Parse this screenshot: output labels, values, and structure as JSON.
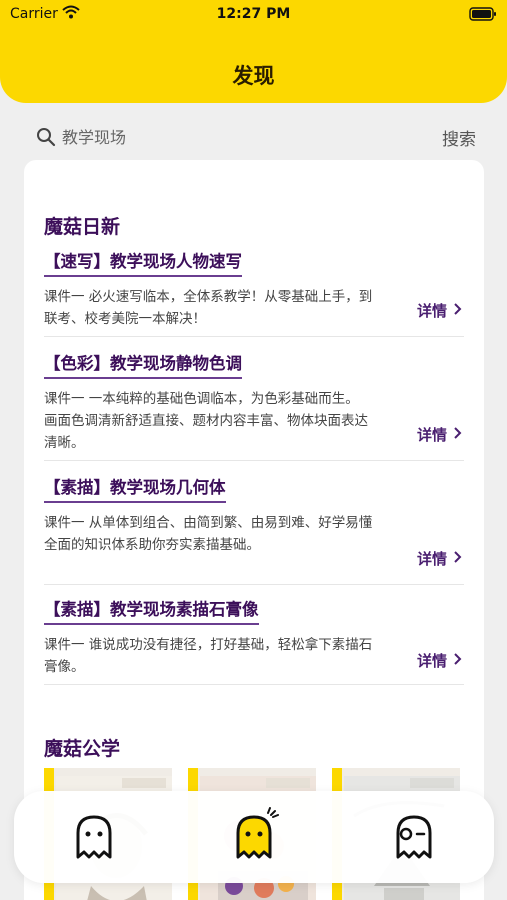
{
  "status_bar": {
    "carrier": "Carrier",
    "time": "12:27 PM"
  },
  "header": {
    "title": "发现"
  },
  "search": {
    "placeholder": "教学现场",
    "button_label": "搜索"
  },
  "section_daily": {
    "title": "魔菇日新",
    "items": [
      {
        "title": "【速写】教学现场人物速写",
        "desc": "课件一 必火速写临本，全体系教学！从零基础上手，到联考、校考美院一本解决！",
        "detail": "详情"
      },
      {
        "title": "【色彩】教学现场静物色调",
        "desc": "课件一 一本纯粹的基础色调临本，为色彩基础而生。 画面色调清新舒适直接、题材内容丰富、物体块面表达清晰。",
        "detail": "详情"
      },
      {
        "title": "【素描】教学现场几何体",
        "desc": "课件一 从单体到组合、由简到繁、由易到难、好学易懂 全面的知识体系助你夯实素描基础。",
        "detail": "详情"
      },
      {
        "title": "【素描】教学现场素描石膏像",
        "desc": "课件一 谁说成功没有捷径，打好基础，轻松拿下素描石膏像。",
        "detail": "详情"
      }
    ]
  },
  "section_public": {
    "title": "魔菇公学"
  },
  "tab_bar": {
    "tabs": [
      {
        "icon": "ghost-icon"
      },
      {
        "icon": "ghost-active-icon"
      },
      {
        "icon": "ghost-wink-icon"
      }
    ]
  },
  "colors": {
    "accent": "#fcd800",
    "title_purple": "#3c0f5a",
    "background": "#efefef"
  }
}
